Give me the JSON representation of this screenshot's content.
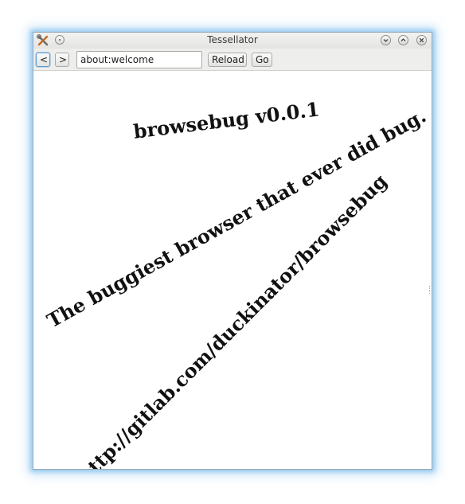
{
  "window": {
    "title": "Tessellator"
  },
  "toolbar": {
    "back_label": "<",
    "forward_label": ">",
    "url_value": "about:welcome",
    "reload_label": "Reload",
    "go_label": "Go"
  },
  "page": {
    "headline": "browsebug v0.0.1",
    "tagline": "The buggiest browser that ever did bug.",
    "link": "http://gitlab.com/duckinator/browsebug"
  },
  "colors": {
    "window_glow": "#5aaae6",
    "titlebar": "#e9e9e7",
    "toolbar": "#eeeeec",
    "content_bg": "#ffffff",
    "text": "#111111"
  },
  "icons": {
    "app": "tools-icon",
    "menu": "window-menu-icon",
    "minimize": "minimize-icon",
    "maximize": "maximize-icon",
    "close": "close-icon"
  }
}
